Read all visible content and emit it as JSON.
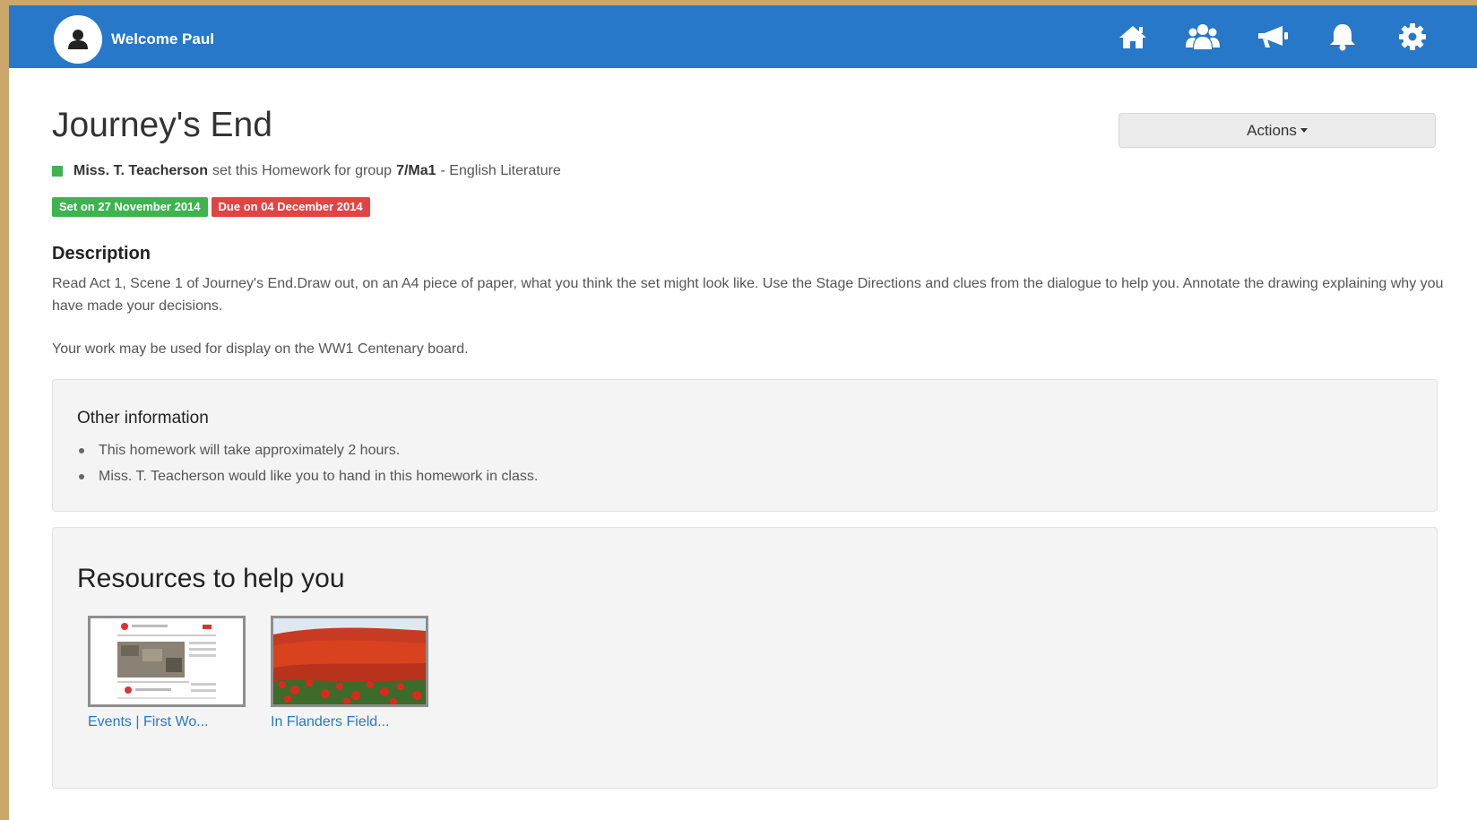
{
  "header": {
    "welcome": "Welcome Paul",
    "icons": [
      "home-icon",
      "group-icon",
      "megaphone-icon",
      "bell-icon",
      "gear-icon"
    ]
  },
  "homework": {
    "title": "Journey's End",
    "actions_label": "Actions",
    "teacher": "Miss. T. Teacherson",
    "set_text": "set this Homework for group",
    "group": "7/Ma1",
    "subject": "- English Literature",
    "set_badge": "Set on 27 November 2014",
    "due_badge": "Due on 04 December 2014"
  },
  "description": {
    "heading": "Description",
    "paragraph1": "Read Act 1, Scene 1 of Journey's End.Draw out, on an A4 piece of paper, what you think the set might look like.  Use the Stage Directions and clues from the dialogue to help you.  Annotate the drawing explaining why you have made your decisions.",
    "paragraph2": "Your work may be used for display on the WW1 Centenary board."
  },
  "other_info": {
    "heading": "Other information",
    "items": [
      "This homework will take approximately 2 hours.",
      "Miss. T. Teacherson would like you to hand in this homework in class."
    ]
  },
  "resources": {
    "heading": "Resources to help you",
    "items": [
      {
        "caption": "Events | First Wo..."
      },
      {
        "caption": "In Flanders Field..."
      }
    ]
  },
  "colors": {
    "nav": "#2778c9",
    "set_badge": "#3fb34f",
    "due_badge": "#e04545",
    "link": "#2778c9"
  }
}
